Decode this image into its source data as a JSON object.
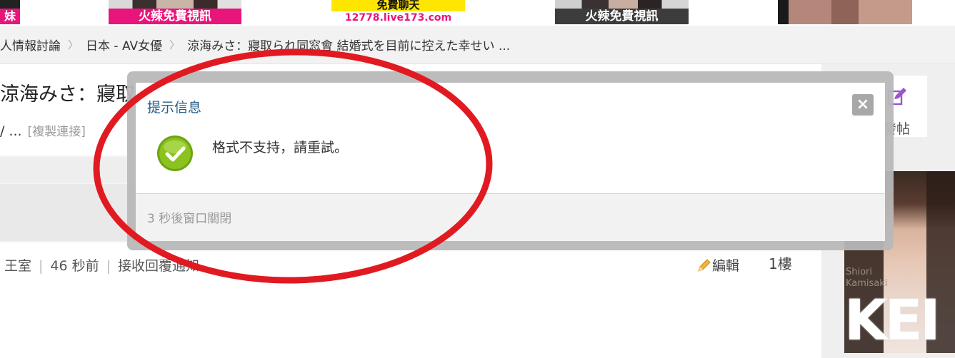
{
  "banner": {
    "ads": [
      {
        "caption": "妹"
      },
      {
        "caption": "火辣免費視訊"
      },
      {
        "caption": "免費聊天",
        "url": "12778.live173.com"
      },
      {
        "caption": "火辣免費視訊"
      },
      {
        "caption": ""
      }
    ]
  },
  "breadcrumb": {
    "items": [
      "人情報討論",
      "日本 - AV女優",
      "涼海みさ：寢取られ同窓會 結婚式を目前に控えた幸せい ..."
    ]
  },
  "post": {
    "title": "涼海みさ：寢取",
    "subtitle": "/ ...",
    "copy_link": "[複製連接]",
    "meta": {
      "author_group": "王室",
      "time": "46 秒前",
      "notify": "接收回覆通知"
    },
    "edit_label": "編輯",
    "floor": "1樓"
  },
  "sidebar": {
    "post_button_label": "發帖",
    "ad": {
      "name_line1": "Shiori",
      "name_line2": "Kamisaki",
      "big_text": "KEI"
    }
  },
  "dialog": {
    "title": "提示信息",
    "message": "格式不支持，請重試。",
    "countdown": "3 秒後窗口關閉",
    "close_symbol": "×"
  },
  "colors": {
    "dialog_title": "#245e8a",
    "annotation": "#e11a22",
    "check": "#8cc21f"
  }
}
